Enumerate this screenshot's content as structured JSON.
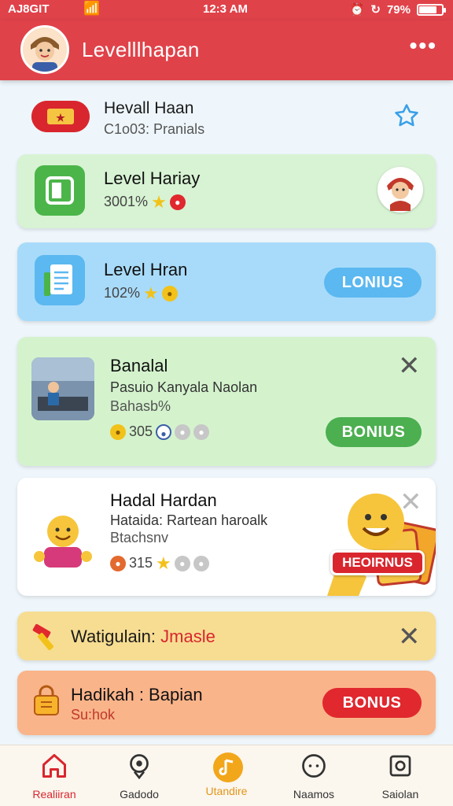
{
  "status_bar": {
    "carrier": "AJ8GIT",
    "time": "12:3 AM",
    "battery": "79%",
    "battery_level": 0.79
  },
  "header": {
    "title": "Levelllhapan"
  },
  "top_item": {
    "title": "Hevall Haan",
    "subtitle": "C1o03: Pranials"
  },
  "cards": [
    {
      "title": "Level Hariay",
      "stat": "3001%"
    },
    {
      "title": "Level Hran",
      "stat": "102%",
      "button": "LONIUS"
    },
    {
      "title": "Banalal",
      "sub1": "Pasuio Kanyala Naolan",
      "sub2": "Bahasb%",
      "count": "305",
      "button": "BONIUS"
    },
    {
      "title": "Hadal Hardan",
      "sub1": "Hataida: Rartean haroalk",
      "sub2": "Btachsnv",
      "count": "315",
      "promo_label": "HEOIRNUS"
    },
    {
      "title_main": "Watigulain:",
      "title_accent": "Jmasle"
    },
    {
      "title": "Hadikah : Bapian",
      "sub": "Su:hok",
      "button": "BONUS"
    }
  ],
  "colors": {
    "brand": "#e0424a",
    "green_button": "#4caf50",
    "blue_button": "#5bb8f0",
    "red_button": "#e0282e"
  },
  "nav": [
    {
      "label": "Realiiran",
      "icon": "home-icon"
    },
    {
      "label": "Gadodo",
      "icon": "location-icon"
    },
    {
      "label": "Utandire",
      "icon": "music-icon"
    },
    {
      "label": "Naamos",
      "icon": "chat-icon"
    },
    {
      "label": "Saiolan",
      "icon": "profile-icon"
    }
  ]
}
